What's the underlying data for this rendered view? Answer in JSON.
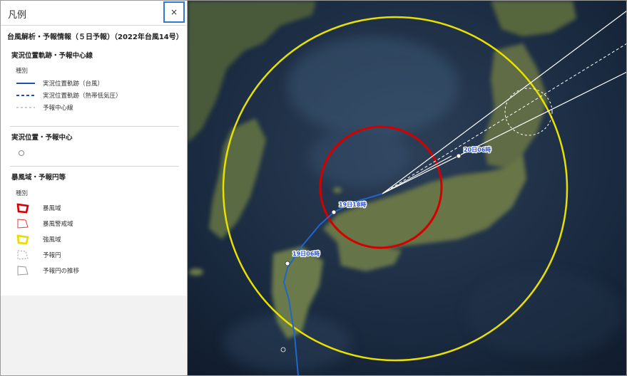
{
  "legend": {
    "title": "凡例",
    "close_label": "×",
    "content_title": "台風解析・予報情報（５日予報）（2022年台風14号）",
    "track_section": {
      "title": "実況位置軌跡・予報中心線",
      "type_label": "種別",
      "items": [
        {
          "label": "実況位置軌跡（台風）",
          "icon": "solid-blue-line"
        },
        {
          "label": "実況位置軌跡（熱帯低気圧）",
          "icon": "dashed-blue-line"
        },
        {
          "label": "予報中心線",
          "icon": "dashed-gray-line"
        }
      ]
    },
    "position_section": {
      "title": "実況位置・予報中心",
      "icon": "circle-marker-icon"
    },
    "area_section": {
      "title": "暴風域・予報円等",
      "type_label": "種別",
      "items": [
        {
          "label": "暴風域",
          "icon": "storm-area-icon",
          "color": "#d40000"
        },
        {
          "label": "暴風警戒域",
          "icon": "storm-warning-area-icon",
          "color": "#e23b3b"
        },
        {
          "label": "強風域",
          "icon": "strong-wind-area-icon",
          "color": "#e6dc00"
        },
        {
          "label": "予報円",
          "icon": "forecast-circle-icon",
          "color": "#999999"
        },
        {
          "label": "予報円の推移",
          "icon": "forecast-circle-transition-icon",
          "color": "#999999"
        }
      ]
    }
  },
  "map": {
    "track_labels": [
      "19日06時",
      "19日18時",
      "20日06時"
    ],
    "colors": {
      "storm": "#d40000",
      "strong_wind": "#e8e000",
      "track": "#1e66cc",
      "forecast": "#ffffff",
      "label_text": "#2a52d6"
    }
  }
}
